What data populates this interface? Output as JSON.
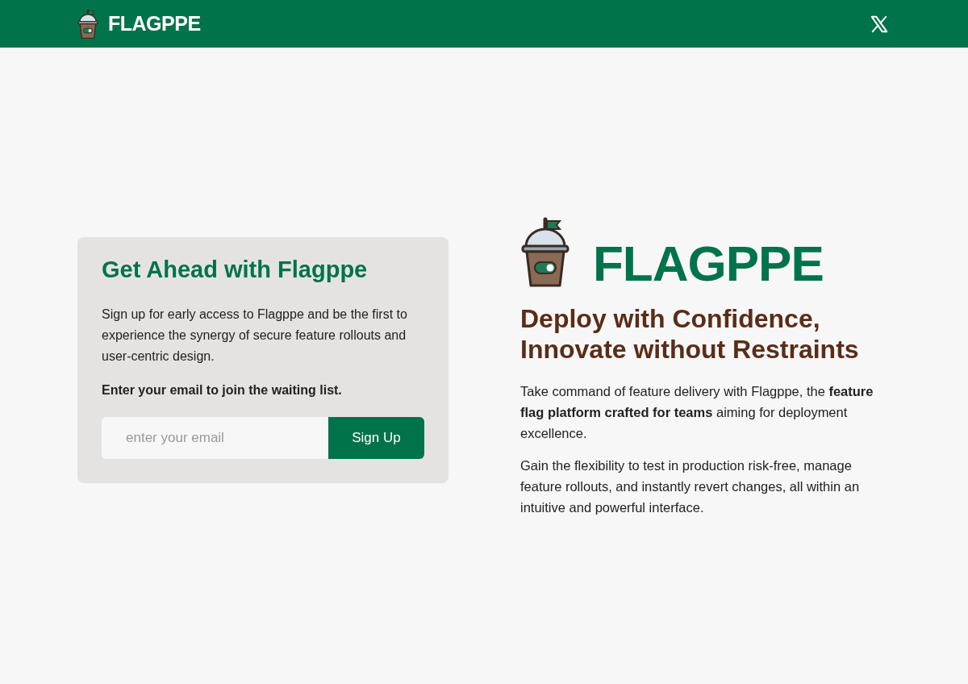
{
  "header": {
    "brand": "FLAGPPE"
  },
  "signup": {
    "title": "Get Ahead with Flagppe",
    "description": "Sign up for early access to Flagppe and be the first to experience the synergy of secure feature rollouts and user-centric design.",
    "prompt": "Enter your email to join the waiting list.",
    "email_placeholder": "enter your email",
    "button": "Sign Up"
  },
  "hero": {
    "brand": "FLAGPPE",
    "headline": "Deploy with Confidence, Innovate without Restraints",
    "paragraphs": [
      "Take command of feature delivery with Flagppe, the **feature flag platform crafted for teams** aiming for deployment excellence.",
      "Gain the flexibility to test in production risk-free, manage feature rollouts, and instantly revert changes, all within an intuitive and powerful interface."
    ]
  }
}
